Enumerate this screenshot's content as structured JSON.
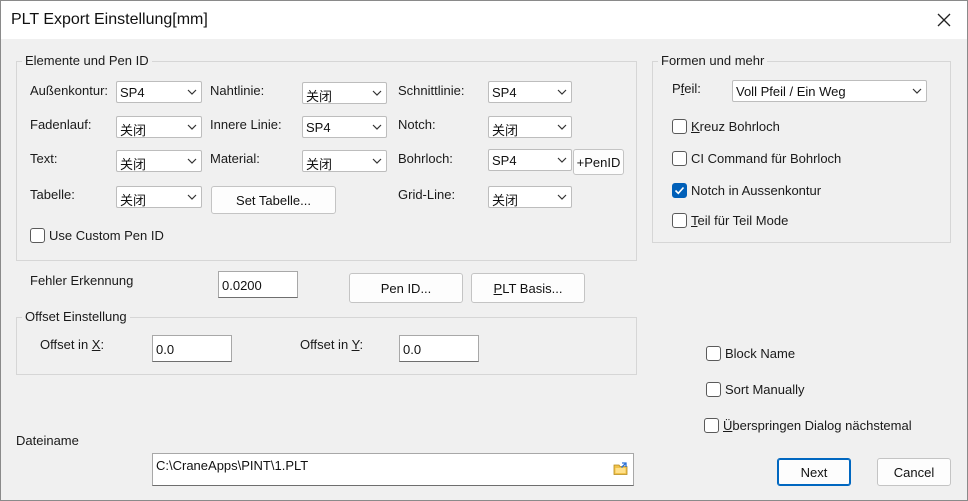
{
  "window": {
    "title": "PLT Export Einstellung[mm]"
  },
  "pen_group": {
    "legend": "Elemente und Pen ID",
    "fields": [
      {
        "label": "Außenkontur:",
        "value": "SP4"
      },
      {
        "label": "Nahtlinie:",
        "value": "关闭"
      },
      {
        "label": "Schnittlinie:",
        "value": "SP4"
      },
      {
        "label": "Fadenlauf:",
        "value": "关闭"
      },
      {
        "label": "Innere Linie:",
        "value": "SP4"
      },
      {
        "label": "Notch:",
        "value": "关闭"
      },
      {
        "label": "Text:",
        "value": "关闭"
      },
      {
        "label": "Material:",
        "value": "关闭"
      },
      {
        "label": "Bohrloch:",
        "value": "SP4"
      },
      {
        "label": "Tabelle:",
        "value": "关闭"
      },
      {
        "label": "Grid-Line:",
        "value": "关闭"
      }
    ],
    "add_pen_button": "+PenID",
    "set_table_button": "Set Tabelle...",
    "custom_pen": {
      "label": "Use Custom Pen ID",
      "checked": false
    }
  },
  "forms_group": {
    "legend": "Formen und mehr",
    "arrow": {
      "label_pre": "P",
      "label_ul": "f",
      "label_post": "eil:",
      "value": "Voll Pfeil / Ein Weg"
    },
    "options": [
      {
        "ul": "K",
        "rest": "reuz Bohrloch",
        "checked": false
      },
      {
        "ul": "",
        "rest": "CI Command für Bohrloch",
        "checked": false
      },
      {
        "ul": "",
        "rest": "Notch in Aussenkontur",
        "checked": true
      },
      {
        "ul": "T",
        "rest": "eil für Teil Mode",
        "checked": false
      }
    ]
  },
  "error": {
    "label": "Fehler Erkennung",
    "value": "0.0200"
  },
  "buttons": {
    "pen_id": "Pen ID...",
    "plt_basis_ul": "P",
    "plt_basis_rest": "LT Basis...",
    "next": "Next",
    "cancel": "Cancel"
  },
  "offset": {
    "legend": "Offset Einstellung",
    "x_label_pre": "Offset in ",
    "x_label_ul": "X",
    "x_label_post": ":",
    "x_value": "0.0",
    "y_label_pre": "Offset in ",
    "y_label_ul": "Y",
    "y_label_post": ":",
    "y_value": "0.0"
  },
  "extra_options": [
    {
      "ul": "",
      "rest": "Block Name",
      "checked": false
    },
    {
      "ul": "",
      "rest": "Sort Manually",
      "checked": false
    },
    {
      "ul": "Ü",
      "rest": "berspringen Dialog nächstemal",
      "checked": false
    }
  ],
  "file": {
    "label": "Dateiname",
    "value": "C:\\CraneApps\\PINT\\1.PLT",
    "icon": "folder-open-icon"
  },
  "colors": {
    "accent": "#005fb8",
    "primary_border": "#0067c0"
  }
}
